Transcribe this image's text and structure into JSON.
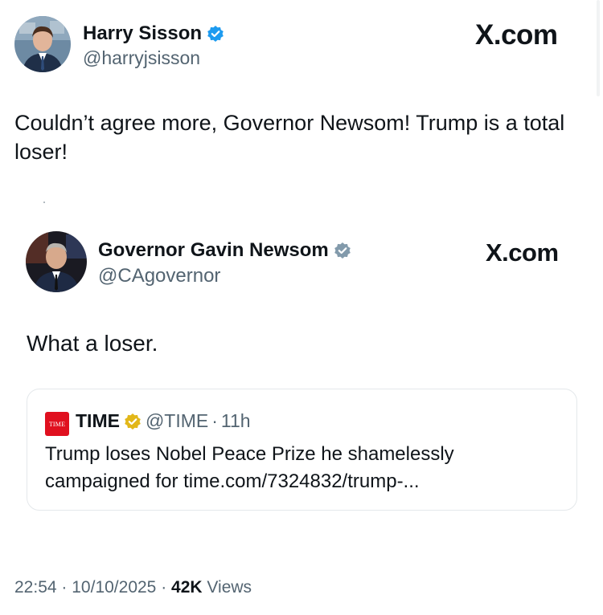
{
  "outer_tweet": {
    "author_name": "Harry Sisson",
    "handle": "@harryjsisson",
    "site_logo": "X.com",
    "text": "Couldn’t agree more, Governor Newsom! Trump is a total loser!",
    "avatar_icon": "profile-photo",
    "verified_icon": "verified-badge-icon",
    "verified_color": "#1d9bf0"
  },
  "embedded_tweet": {
    "author_name": "Governor Gavin Newsom",
    "handle": "@CAgovernor",
    "site_logo": "X.com",
    "text": "What a loser.",
    "avatar_icon": "profile-photo",
    "verified_icon": "government-badge-icon",
    "verified_color": "#829aab"
  },
  "quoted_tweet": {
    "logo_text": "TIME",
    "author_name": "TIME",
    "handle": "@TIME",
    "separator": "·",
    "time_ago": "11h",
    "text": "Trump loses Nobel Peace Prize he shamelessly campaigned for time.com/7324832/trump-...",
    "verified_icon": "gold-badge-icon",
    "verified_color": "#e2b719",
    "brand_color": "#e0101f"
  },
  "meta": {
    "time": "22:54",
    "sep1": "·",
    "date": "10/10/2025",
    "sep2": "·",
    "views_count": "42K",
    "views_label": "Views"
  }
}
